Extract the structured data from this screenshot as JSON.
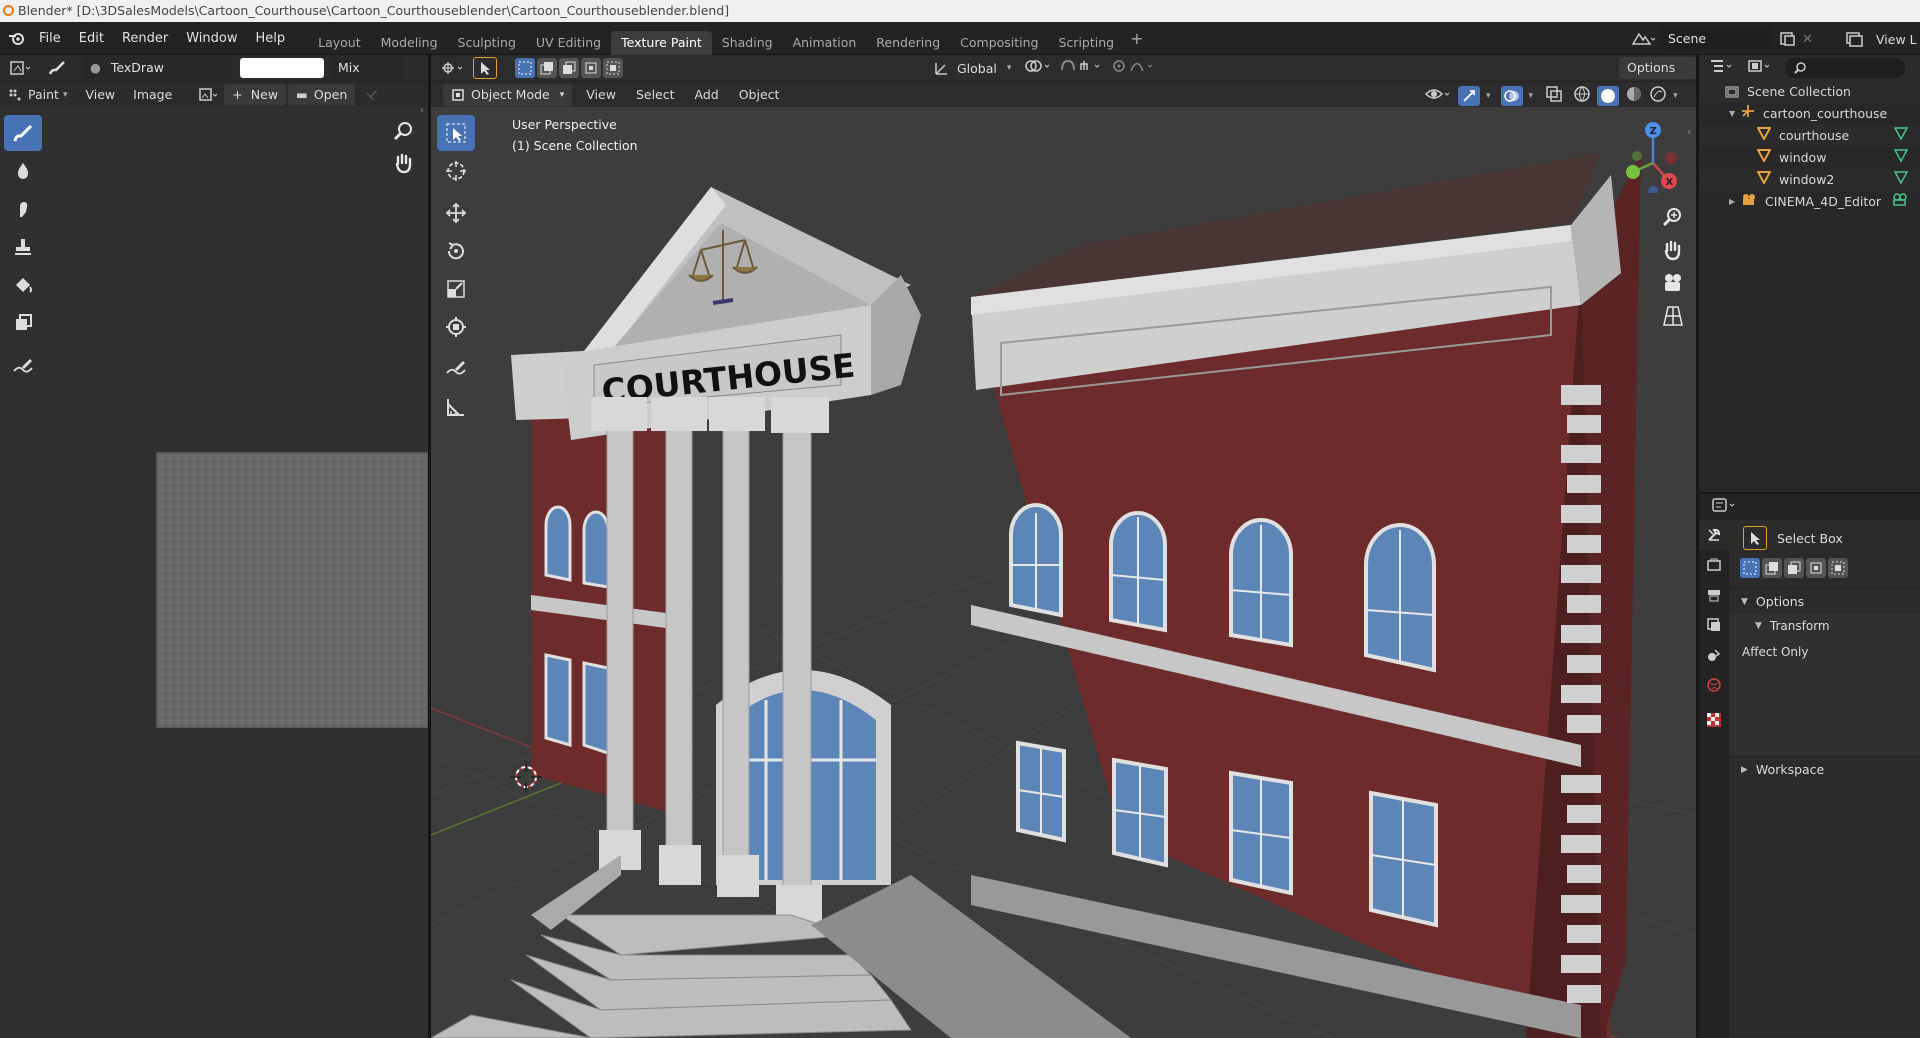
{
  "titlebar": {
    "text": "Blender* [D:\\3DSalesModels\\Cartoon_Courthouse\\Cartoon_Courthouseblender\\Cartoon_Courthouseblender.blend]"
  },
  "menu": {
    "file": "File",
    "edit": "Edit",
    "render": "Render",
    "window": "Window",
    "help": "Help"
  },
  "workspaces": [
    {
      "label": "Layout"
    },
    {
      "label": "Modeling"
    },
    {
      "label": "Sculpting"
    },
    {
      "label": "UV Editing"
    },
    {
      "label": "Texture Paint",
      "active": true
    },
    {
      "label": "Shading"
    },
    {
      "label": "Animation"
    },
    {
      "label": "Rendering"
    },
    {
      "label": "Compositing"
    },
    {
      "label": "Scripting"
    }
  ],
  "scene": {
    "name": "Scene",
    "view_layer": "View L"
  },
  "image_editor": {
    "brush_name": "TexDraw",
    "blend_mode": "Mix",
    "mode": "Paint",
    "view": "View",
    "image": "Image",
    "new": "New",
    "open": "Open"
  },
  "viewport": {
    "object_mode": "Object Mode",
    "view": "View",
    "select": "Select",
    "add": "Add",
    "object": "Object",
    "orientation": "Global",
    "options": "Options",
    "perspective": "User Perspective",
    "collection": "(1) Scene Collection",
    "sign_text": "COURTHOUSE"
  },
  "outliner": {
    "root": "Scene Collection",
    "items": [
      {
        "label": "cartoon_courthouse",
        "indent": 1
      },
      {
        "label": "courthouse",
        "indent": 2
      },
      {
        "label": "window",
        "indent": 2
      },
      {
        "label": "window2",
        "indent": 2
      },
      {
        "label": "CINEMA_4D_Editor",
        "indent": 1
      }
    ]
  },
  "properties": {
    "tool": "Select Box",
    "options": "Options",
    "transform": "Transform",
    "affect_only": "Affect Only",
    "workspace": "Workspace"
  },
  "colors": {
    "accent": "#4772b3",
    "brick": "#6e2b2b",
    "trim": "#bfbfbf"
  }
}
